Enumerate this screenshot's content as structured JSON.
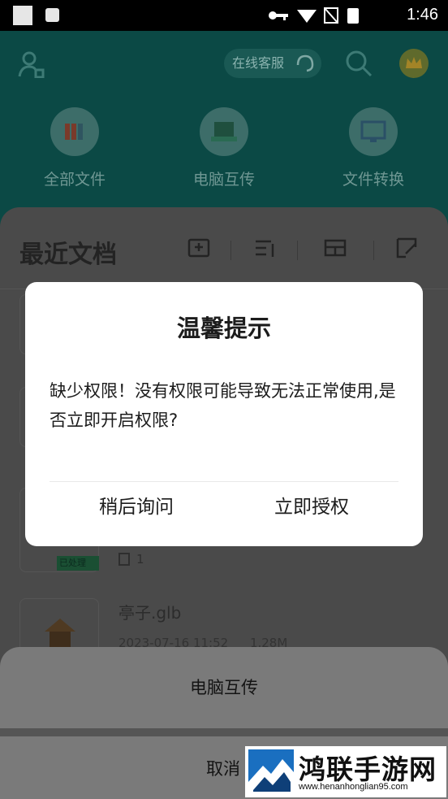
{
  "status_bar": {
    "time": "1:46"
  },
  "header": {
    "online_service": "在线客服",
    "features": [
      {
        "label": "全部文件",
        "icon": "books-icon"
      },
      {
        "label": "电脑互传",
        "icon": "pc-transfer-icon"
      },
      {
        "label": "文件转换",
        "icon": "monitor-convert-icon"
      }
    ]
  },
  "recent": {
    "title": "最近文档",
    "badge": "已处理",
    "count": "1",
    "file": {
      "name": "亭子.glb",
      "date": "2023-07-16 11:52",
      "size": "1.28M"
    }
  },
  "dialog": {
    "title": "温馨提示",
    "message": "缺少权限！没有权限可能导致无法正常使用,是否立即开启权限?",
    "later_label": "稍后询问",
    "authorize_label": "立即授权"
  },
  "bottom_sheet": {
    "option_label": "电脑互传",
    "cancel_label": "取消"
  },
  "watermark": {
    "name": "鸿联手游网",
    "url": "www.henanhonglian95.com"
  }
}
